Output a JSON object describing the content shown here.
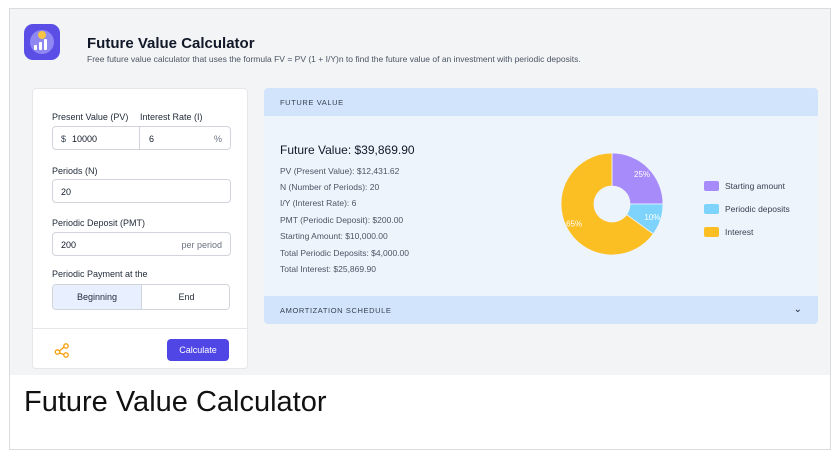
{
  "header": {
    "title": "Future Value Calculator",
    "subtitle": "Free future value calculator that uses the formula FV = PV (1 + I/Y)n to find the future value of an investment with periodic deposits.",
    "logo_icon": "calculator-chart-icon"
  },
  "form": {
    "present_value_label": "Present Value (PV)",
    "present_value_prefix": "$",
    "present_value": "10000",
    "interest_rate_label": "Interest Rate (I)",
    "interest_rate": "6",
    "interest_rate_suffix": "%",
    "periods_label": "Periods (N)",
    "periods": "20",
    "deposit_label": "Periodic Deposit (PMT)",
    "deposit": "200",
    "deposit_suffix": "per period",
    "payment_at_label": "Periodic Payment at the",
    "payment_options": [
      "Beginning",
      "End"
    ],
    "payment_selected": "Beginning",
    "share_icon": "share-icon",
    "calculate_label": "Calculate"
  },
  "results": {
    "section_label": "FUTURE VALUE",
    "future_value": "Future Value: $39,869.90",
    "lines": [
      "PV (Present Value): $12,431.62",
      "N (Number of Periods): 20",
      "I/Y (Interest Rate): 6",
      "PMT (Periodic Deposit): $200.00",
      "Starting Amount: $10,000.00",
      "Total Periodic Deposits: $4,000.00",
      "Total Interest: $25,869.90"
    ],
    "amortization_label": "AMORTIZATION SCHEDULE",
    "amortization_icon": "chevron-down-icon"
  },
  "chart_data": {
    "type": "pie",
    "categories": [
      "Starting amount",
      "Periodic deposits",
      "Interest"
    ],
    "values": [
      25,
      10,
      65
    ],
    "labels": [
      "25%",
      "10%",
      "65%"
    ],
    "colors": [
      "#a78bfa",
      "#7dd3fc",
      "#fbbf24"
    ],
    "donut": true,
    "legend": "right"
  },
  "colors": {
    "accent": "#4f46e5",
    "section_header": "#d2e4fb",
    "result_bg": "#eef4fc",
    "share_icon": "#f59e0b"
  },
  "caption": "Future Value Calculator"
}
